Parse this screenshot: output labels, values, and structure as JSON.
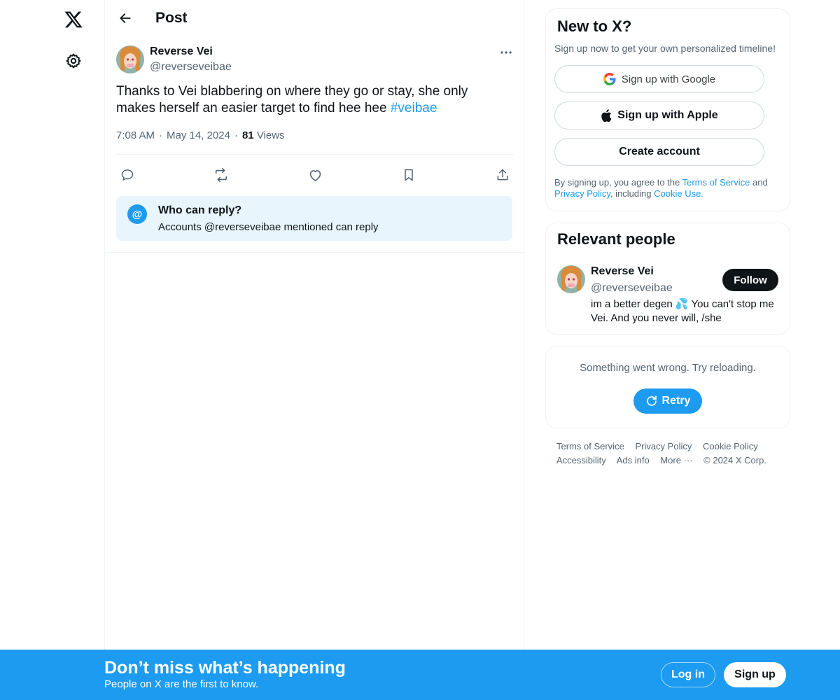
{
  "colors": {
    "accent": "#1d9bf0",
    "text": "#0f1419",
    "muted": "#536471",
    "border": "#eff3f4",
    "reply_bg": "#e8f5fd"
  },
  "nav": {
    "logo_icon": "x-logo-icon",
    "settings_icon": "gear-icon"
  },
  "header": {
    "back_icon": "arrow-left-icon",
    "title": "Post"
  },
  "post": {
    "author_name": "Reverse Vei",
    "author_handle": "@reverseveibae",
    "text": "Thanks to Vei blabbering on where they go or stay, she only makes herself an easier target to find hee hee ",
    "hashtag": "#veibae",
    "time": "7:08 AM",
    "separator": "·",
    "date": "May 14, 2024",
    "views_count": "81",
    "views_label": "Views",
    "actions": [
      "reply-icon",
      "repost-icon",
      "like-icon",
      "bookmark-icon",
      "share-icon"
    ]
  },
  "reply_settings": {
    "icon": "@",
    "title": "Who can reply?",
    "subtitle": "Accounts @reverseveibae mentioned can reply"
  },
  "signup_card": {
    "title": "New to X?",
    "subtitle": "Sign up now to get your own personalized timeline!",
    "google_label": "Sign up with Google",
    "apple_label": "Sign up with Apple",
    "create_label": "Create account",
    "legal_prefix": "By signing up, you agree to the ",
    "terms_link": "Terms of Service",
    "legal_and": " and ",
    "privacy_link": "Privacy Policy",
    "legal_including": ", including ",
    "cookie_link": "Cookie Use."
  },
  "relevant_people": {
    "title": "Relevant people",
    "name": "Reverse Vei",
    "handle": "@reverseveibae",
    "follow_label": "Follow",
    "bio": "im a better degen 💦 You can't stop me Vei. And you never will, /she"
  },
  "error_card": {
    "message": "Something went wrong. Try reloading.",
    "retry_label": "Retry"
  },
  "footer": {
    "links": [
      "Terms of Service",
      "Privacy Policy",
      "Cookie Policy",
      "Accessibility",
      "Ads info",
      "More ···"
    ],
    "copyright": "© 2024 X Corp."
  },
  "bottom_bar": {
    "title": "Don’t miss what’s happening",
    "subtitle": "People on X are the first to know.",
    "login_label": "Log in",
    "signup_label": "Sign up"
  }
}
